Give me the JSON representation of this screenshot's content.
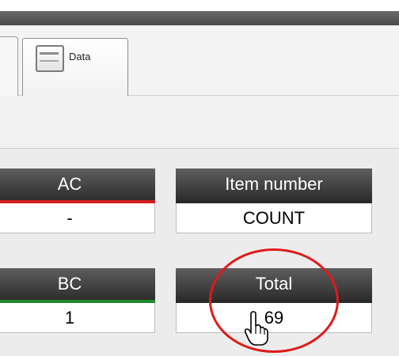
{
  "window": {
    "titlebar_color": "#555555"
  },
  "tabs": [
    {
      "label": "Data",
      "icon": "data-drawer-icon"
    }
  ],
  "fields": {
    "ac": {
      "label": "AC",
      "value": "-",
      "stripe_color": "#d41f1f"
    },
    "item_number": {
      "label": "Item number",
      "value": "COUNT"
    },
    "bc": {
      "label": "BC",
      "value": "1",
      "stripe_color": "#1f8a2a"
    },
    "total": {
      "label": "Total",
      "value": "69"
    }
  },
  "annotation": {
    "highlight_color": "#e01a1a",
    "cursor": "hand-pointer-icon"
  }
}
